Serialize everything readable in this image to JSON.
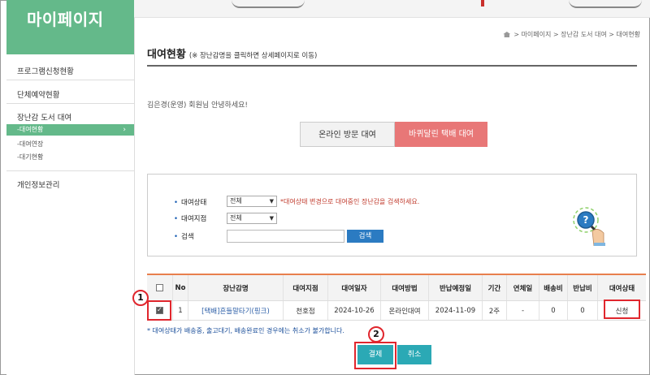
{
  "sidebar": {
    "title": "마이페이지",
    "items": [
      {
        "label": "프로그램신청현황"
      },
      {
        "label": "단체예약현황"
      },
      {
        "label": "장난감 도서 대여"
      },
      {
        "label": "개인정보관리"
      }
    ],
    "subitems": [
      {
        "label": "-대여현황",
        "active": true
      },
      {
        "label": "-대여연장"
      },
      {
        "label": "-대기현황"
      }
    ],
    "active_arrow": "›"
  },
  "breadcrumb": "> 마이페이지 > 장난감 도서 대여 > 대여현황",
  "page": {
    "title": "대여현황",
    "subtitle": "(※ 장난감명을 클릭하면 상세페이지로 이동)",
    "greeting": "김은경(운영) 회원님 안녕하세요!"
  },
  "tabs": {
    "visit": "온라인 방문 대여",
    "delivery": "바퀴달린 택배 대여"
  },
  "search": {
    "status_label": "대여상태",
    "status_value": "전체",
    "status_hint": "*대여상태 변경으로 대여중인 장난감을 검색하세요.",
    "branch_label": "대여지점",
    "branch_value": "전체",
    "keyword_label": "검색",
    "keyword_value": "",
    "button": "검색"
  },
  "table": {
    "headers": [
      "",
      "No",
      "장난감명",
      "대여지점",
      "대여일자",
      "대여방법",
      "반납예정일",
      "기간",
      "연체일",
      "배송비",
      "반납비",
      "대여상태"
    ],
    "rows": [
      {
        "checked": true,
        "no": "1",
        "name": "[택배]흔들말타기(핑크)",
        "branch": "천호점",
        "date": "2024-10-26",
        "method": "온라인대여",
        "due": "2024-11-09",
        "period": "2주",
        "overdue": "-",
        "ship_fee": "0",
        "return_fee": "0",
        "status": "신청"
      }
    ]
  },
  "note": "* 대여상태가 배송중, 출고대기, 배송완료인 경우에는 취소가 불가합니다.",
  "buttons": {
    "pay": "결제",
    "cancel": "취소"
  },
  "annotations": {
    "one": "1",
    "two": "2"
  },
  "colors": {
    "green": "#64b98a",
    "pink": "#e87777",
    "teal": "#2ba9b5",
    "blue": "#2b7bc2",
    "annotation_red": "#e0262d"
  }
}
